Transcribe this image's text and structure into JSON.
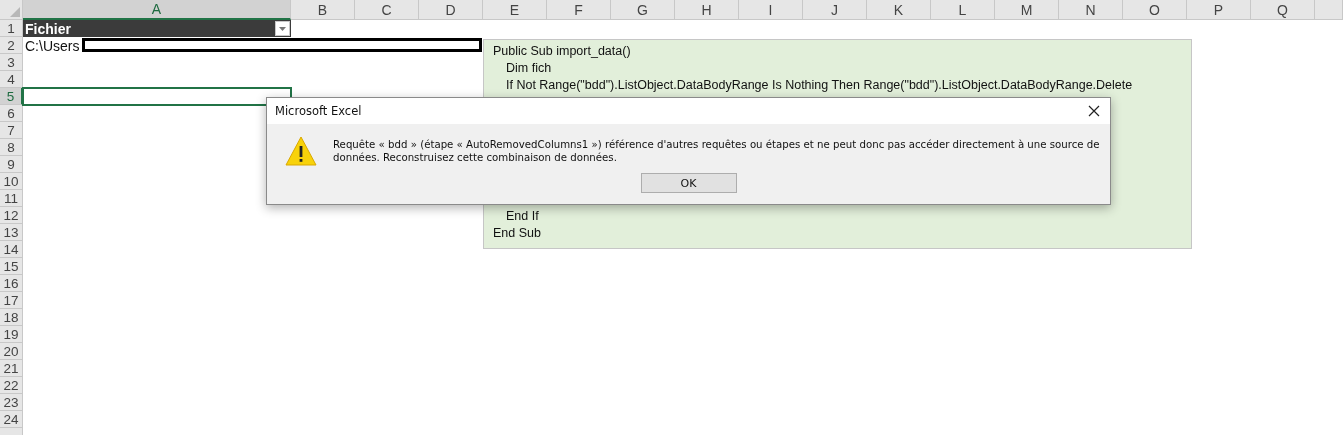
{
  "columns": [
    {
      "label": "A",
      "selected": true
    },
    {
      "label": "B",
      "selected": false
    },
    {
      "label": "C",
      "selected": false
    },
    {
      "label": "D",
      "selected": false
    },
    {
      "label": "E",
      "selected": false
    },
    {
      "label": "F",
      "selected": false
    },
    {
      "label": "G",
      "selected": false
    },
    {
      "label": "H",
      "selected": false
    },
    {
      "label": "I",
      "selected": false
    },
    {
      "label": "J",
      "selected": false
    },
    {
      "label": "K",
      "selected": false
    },
    {
      "label": "L",
      "selected": false
    },
    {
      "label": "M",
      "selected": false
    },
    {
      "label": "N",
      "selected": false
    },
    {
      "label": "O",
      "selected": false
    },
    {
      "label": "P",
      "selected": false
    },
    {
      "label": "Q",
      "selected": false
    }
  ],
  "rows": [
    {
      "label": "1",
      "selected": false
    },
    {
      "label": "2",
      "selected": false
    },
    {
      "label": "3",
      "selected": false
    },
    {
      "label": "4",
      "selected": false
    },
    {
      "label": "5",
      "selected": true
    },
    {
      "label": "6",
      "selected": false
    },
    {
      "label": "7",
      "selected": false
    },
    {
      "label": "8",
      "selected": false
    },
    {
      "label": "9",
      "selected": false
    },
    {
      "label": "10",
      "selected": false
    },
    {
      "label": "11",
      "selected": false
    },
    {
      "label": "12",
      "selected": false
    },
    {
      "label": "13",
      "selected": false
    },
    {
      "label": "14",
      "selected": false
    },
    {
      "label": "15",
      "selected": false
    },
    {
      "label": "16",
      "selected": false
    },
    {
      "label": "17",
      "selected": false
    },
    {
      "label": "18",
      "selected": false
    },
    {
      "label": "19",
      "selected": false
    },
    {
      "label": "20",
      "selected": false
    },
    {
      "label": "21",
      "selected": false
    },
    {
      "label": "22",
      "selected": false
    },
    {
      "label": "23",
      "selected": false
    },
    {
      "label": "24",
      "selected": false
    }
  ],
  "table_header": {
    "text": "Fichier"
  },
  "cell_a2": {
    "text": "C:\\Users"
  },
  "text_box": {
    "top_lines": [
      {
        "text": "Public Sub import_data()",
        "kind": "plain"
      },
      {
        "text": "Dim fich",
        "kind": "indented"
      },
      {
        "text": "If Not Range(\"bdd\").ListObject.DataBodyRange Is Nothing Then Range(\"bdd\").ListObject.DataBodyRange.Delete",
        "kind": "indented"
      }
    ],
    "bottom_lines": [
      {
        "text": "End If",
        "kind": "indented"
      },
      {
        "text": "End Sub",
        "kind": "plain"
      }
    ]
  },
  "dialog": {
    "title": "Microsoft Excel",
    "message": "Requête « bdd » (étape « AutoRemovedColumns1 ») référence d'autres requêtes ou étapes et ne peut donc pas accéder directement à une source de données. Reconstruisez cette combinaison de données.",
    "button": "OK"
  }
}
